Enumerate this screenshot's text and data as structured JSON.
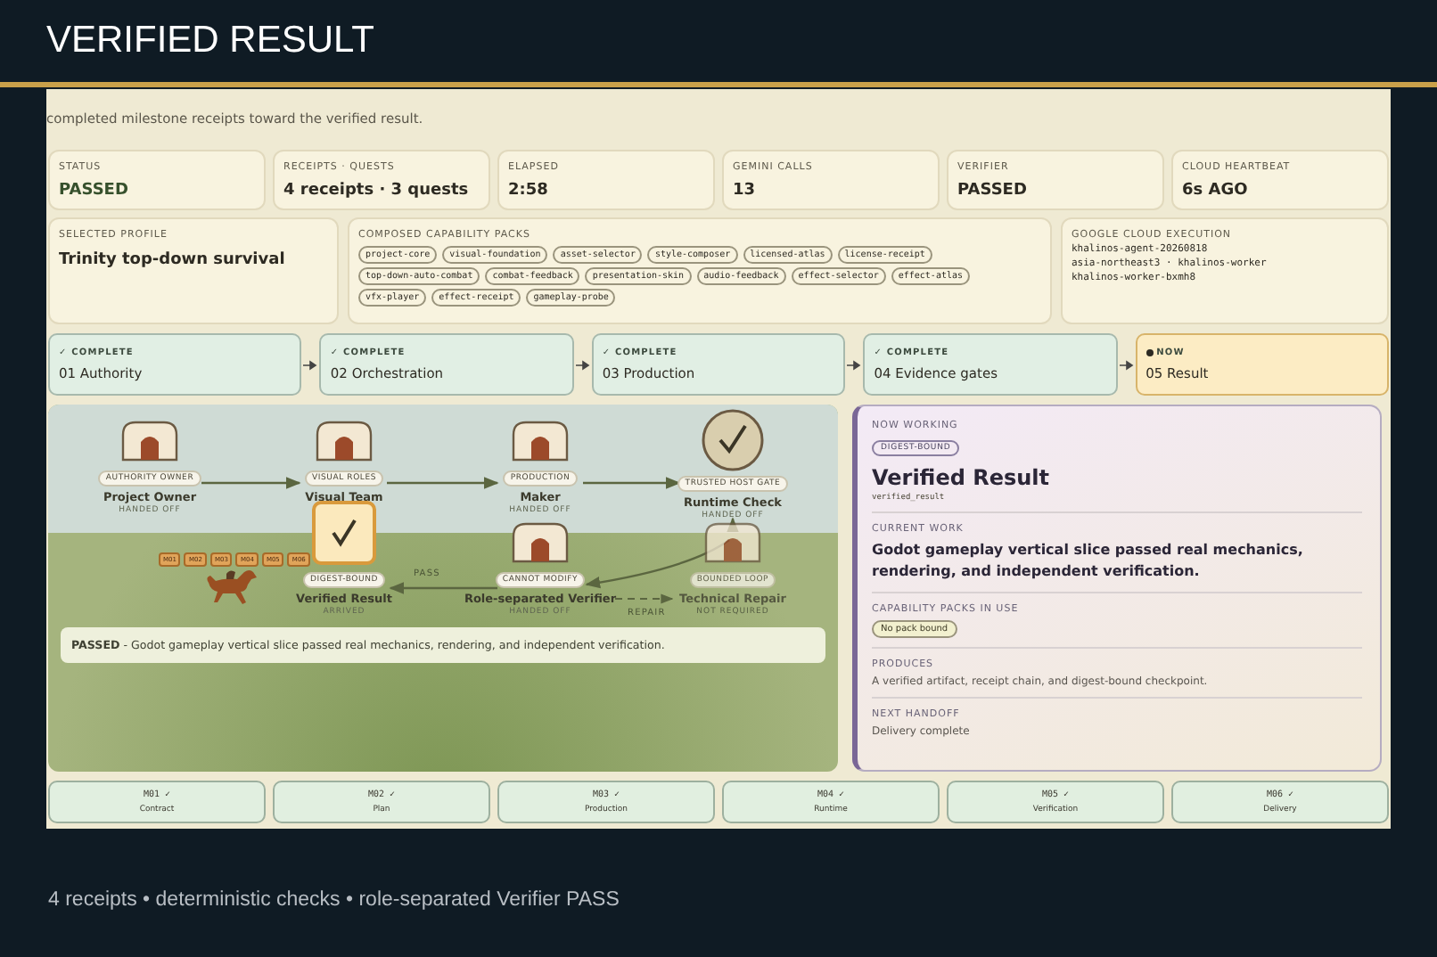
{
  "header": {
    "title": "VERIFIED RESULT"
  },
  "intro": "completed milestone receipts toward the verified result.",
  "stats": [
    {
      "label": "STATUS",
      "value": "PASSED",
      "kind": "good"
    },
    {
      "label": "RECEIPTS · QUESTS",
      "value": "4 receipts · 3 quests",
      "kind": "plain"
    },
    {
      "label": "ELAPSED",
      "value": "2:58",
      "kind": "plain"
    },
    {
      "label": "GEMINI CALLS",
      "value": "13",
      "kind": "plain"
    },
    {
      "label": "VERIFIER",
      "value": "PASSED",
      "kind": "plain"
    },
    {
      "label": "CLOUD HEARTBEAT",
      "value": "6s AGO",
      "kind": "plain"
    }
  ],
  "profile": {
    "label": "SELECTED PROFILE",
    "value": "Trinity top-down survival"
  },
  "packs": {
    "label": "COMPOSED CAPABILITY PACKS",
    "items": [
      "project-core",
      "visual-foundation",
      "asset-selector",
      "style-composer",
      "licensed-atlas",
      "license-receipt",
      "top-down-auto-combat",
      "combat-feedback",
      "presentation-skin",
      "audio-feedback",
      "effect-selector",
      "effect-atlas",
      "vfx-player",
      "effect-receipt",
      "gameplay-probe"
    ]
  },
  "cloud": {
    "label": "GOOGLE CLOUD EXECUTION",
    "lines": [
      "khalinos-agent-20260818",
      "asia-northeast3 · khalinos-worker",
      "khalinos-worker-bxmh8"
    ]
  },
  "steps": [
    {
      "current": false,
      "status": "✓ COMPLETE",
      "name": "01 Authority"
    },
    {
      "current": false,
      "status": "✓ COMPLETE",
      "name": "02 Orchestration"
    },
    {
      "current": false,
      "status": "✓ COMPLETE",
      "name": "03 Production"
    },
    {
      "current": false,
      "status": "✓ COMPLETE",
      "name": "04 Evidence gates"
    },
    {
      "current": true,
      "status": "NOW",
      "name": "05 Result"
    }
  ],
  "diagram": {
    "nodes": [
      {
        "kind": "hut",
        "tag": "AUTHORITY OWNER",
        "name": "Project Owner",
        "status": "HANDED OFF",
        "dimmed": false
      },
      {
        "kind": "hut",
        "tag": "VISUAL ROLES",
        "name": "Visual Team",
        "dimmed": false
      },
      {
        "kind": "hut",
        "tag": "PRODUCTION",
        "name": "Maker",
        "status": "HANDED OFF",
        "dimmed": false
      },
      {
        "kind": "gate",
        "tag": "TRUSTED HOST GATE",
        "name": "Runtime Check",
        "status": "HANDED OFF",
        "dimmed": false
      },
      {
        "kind": "result",
        "tag": "DIGEST-BOUND",
        "name": "Verified Result",
        "status": "ARRIVED",
        "dimmed": false
      },
      {
        "kind": "hut",
        "tag": "CANNOT MODIFY",
        "name": "Role-separated Verifier",
        "status": "HANDED OFF",
        "dimmed": false
      },
      {
        "kind": "hut",
        "tag": "BOUNDED LOOP",
        "name": "Technical Repair",
        "status": "NOT REQUIRED",
        "dimmed": true
      }
    ],
    "edge_labels": [
      "PASS",
      "REPAIR"
    ],
    "receipts": [
      "M01",
      "M02",
      "M03",
      "M04",
      "M05",
      "M06"
    ],
    "verdict": "**PASSED** - Godot gameplay vertical slice passed real mechanics, rendering, and independent verification."
  },
  "detail": {
    "eyebrow": "NOW WORKING",
    "badge": "DIGEST-BOUND",
    "title": "Verified Result",
    "id": "verified_result",
    "sections": [
      {
        "kind": "strong",
        "label": "CURRENT WORK",
        "text": "Godot gameplay vertical slice passed real mechanics, rendering, and independent verification."
      },
      {
        "kind": "pill",
        "label": "CAPABILITY PACKS IN USE",
        "text": "No pack bound"
      },
      {
        "kind": "text",
        "label": "PRODUCES",
        "text": "A verified artifact, receipt chain, and digest-bound checkpoint."
      },
      {
        "kind": "text",
        "label": "NEXT HANDOFF",
        "text": "Delivery complete"
      }
    ]
  },
  "milestones": [
    {
      "code": "M01 ✓",
      "name": "Contract"
    },
    {
      "code": "M02 ✓",
      "name": "Plan"
    },
    {
      "code": "M03 ✓",
      "name": "Production"
    },
    {
      "code": "M04 ✓",
      "name": "Runtime"
    },
    {
      "code": "M05 ✓",
      "name": "Verification"
    },
    {
      "code": "M06 ✓",
      "name": "Delivery"
    }
  ],
  "caption": "4 receipts • deterministic checks • role-separated Verifier PASS"
}
